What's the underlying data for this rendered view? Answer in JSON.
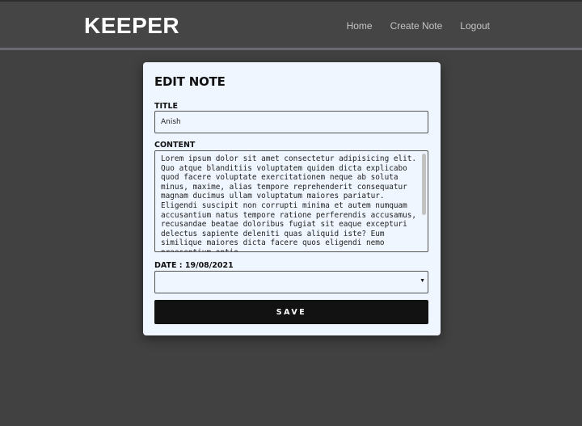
{
  "navbar": {
    "brand": "KEEPER",
    "links": [
      {
        "label": "Home"
      },
      {
        "label": "Create Note"
      },
      {
        "label": "Logout"
      }
    ]
  },
  "form": {
    "heading": "EDIT NOTE",
    "title_label": "TITLE",
    "title_value": "Anish",
    "content_label": "CONTENT",
    "content_value": "Lorem ipsum dolor sit amet consectetur adipisicing elit. Quo atque blanditiis voluptatem quidem dicta explicabo quod facere voluptate exercitationem neque ab soluta minus, maxime, alias tempore reprehenderit consequatur magnam ducimus ullam voluptatum maiores pariatur. Eligendi suscipit non corrupti minima et autem numquam accusantium natus tempore ratione perferendis accusamus, recusandae beatae doloribus fugiat sit eaque excepturi delectus sapiente deleniti quas aliquid iste? Eum similique maiores dicta facere quos eligendi nemo praesentium optio",
    "date_label": "DATE : 19/08/2021",
    "save_label": "SAVE"
  },
  "colors": {
    "page_background": "#414141",
    "navbar_background": "#454545",
    "card_background": "#eff6ff",
    "button_background": "#121212"
  }
}
